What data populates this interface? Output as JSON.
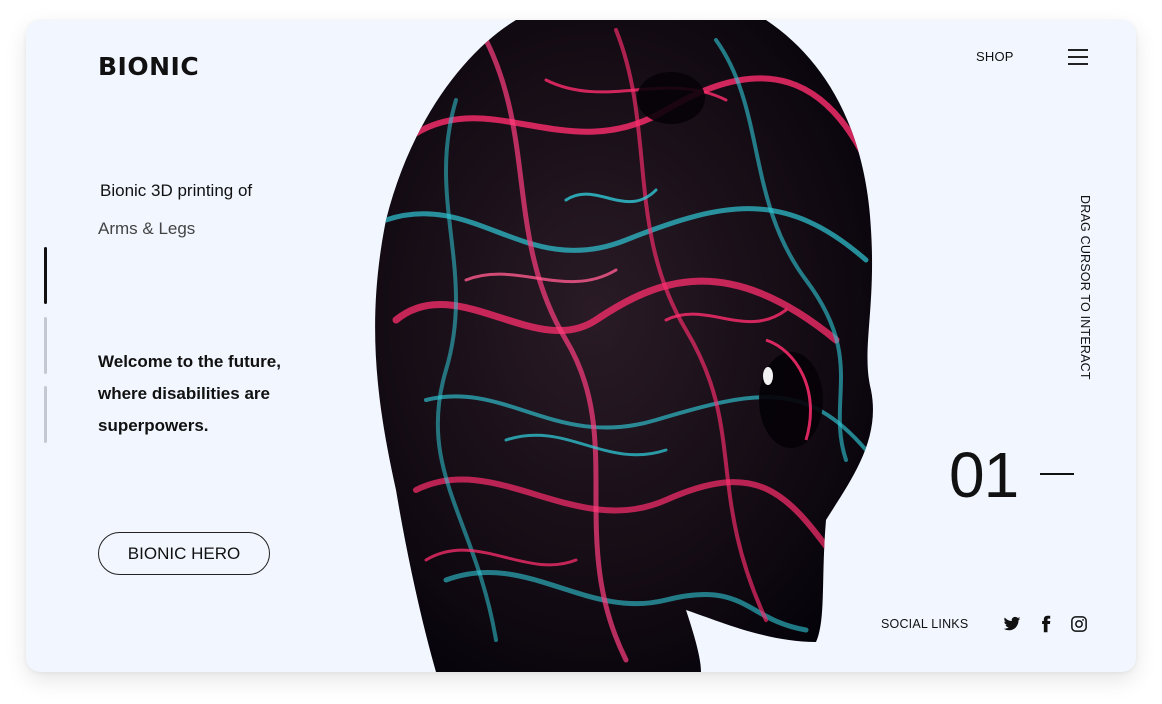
{
  "brand": {
    "logo_text": "BIONIC"
  },
  "nav": {
    "shop_label": "SHOP",
    "menu_icon": "hamburger-menu-icon"
  },
  "hero": {
    "subtitle_line1": "Bionic 3D printing of",
    "subtitle_line2": "Arms & Legs",
    "tagline": "Welcome to the future, where disabilities are superpowers.",
    "cta_label": "BIONIC HERO"
  },
  "slider": {
    "slide_count": 3,
    "active_index": 1,
    "current_number": "01"
  },
  "hint": {
    "text": "DRAG CURSOR TO INTERACT"
  },
  "social": {
    "label": "SOCIAL LINKS",
    "icons": [
      "twitter-icon",
      "facebook-icon",
      "instagram-icon"
    ]
  },
  "colors": {
    "background": "#f2f6ff",
    "text": "#111111",
    "accent_pink": "#ff2d6e",
    "accent_cyan": "#2fc8d6",
    "inactive_bar": "#c3c8d2"
  }
}
